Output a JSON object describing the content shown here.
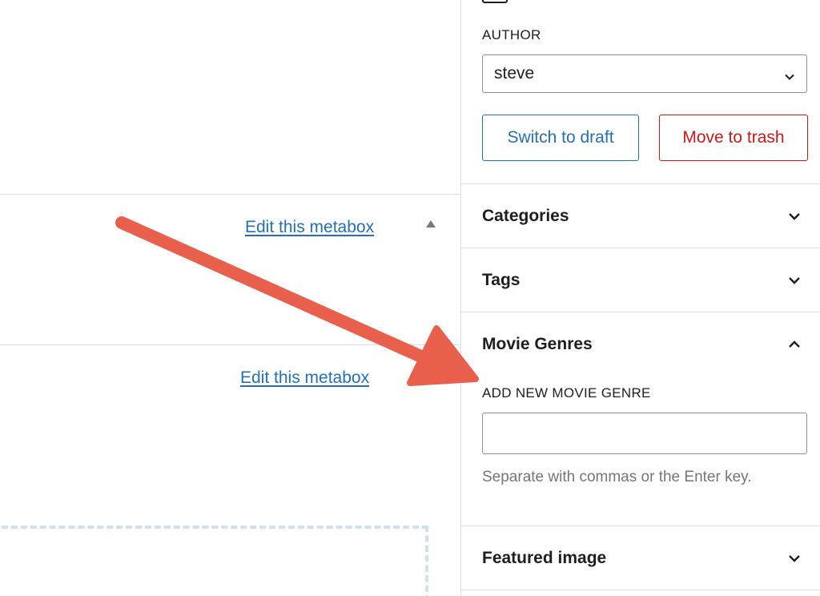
{
  "main": {
    "metabox_links": [
      "Edit this metabox",
      "Edit this metabox"
    ]
  },
  "sidebar": {
    "author": {
      "label": "AUTHOR",
      "selected": "steve"
    },
    "buttons": {
      "switch_to_draft": "Switch to draft",
      "move_to_trash": "Move to trash"
    },
    "panels": {
      "categories": "Categories",
      "tags": "Tags",
      "movie_genres": "Movie Genres",
      "featured_image": "Featured image"
    },
    "movie_genres": {
      "add_label": "ADD NEW MOVIE GENRE",
      "input_value": "",
      "help": "Separate with commas or the Enter key."
    }
  },
  "colors": {
    "link": "#2271b1",
    "danger": "#cc1818",
    "annotation_arrow": "#e8604c",
    "border": "#dcdcde"
  },
  "icons": {
    "collapse": "triangle-up-icon",
    "expand": "chevron-down-icon",
    "expanded": "chevron-up-icon"
  }
}
